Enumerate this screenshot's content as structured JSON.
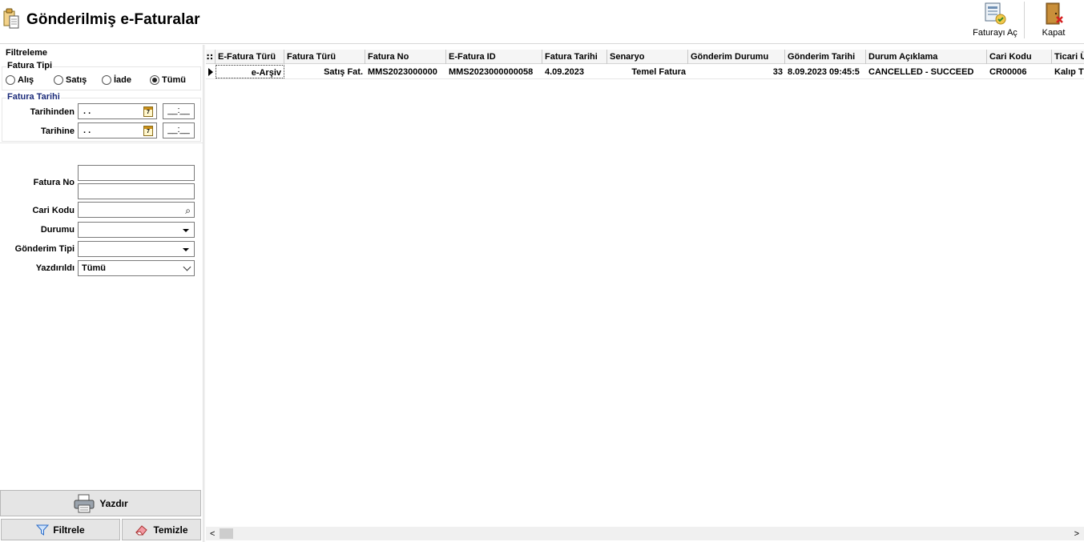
{
  "window": {
    "title": "Gönderilmiş e-Faturalar",
    "icon": "document-clipboard-icon"
  },
  "toolbar": {
    "open_invoice_label": "Faturayı Aç",
    "close_label": "Kapat"
  },
  "filter": {
    "title": "Filtreleme",
    "invoice_type": {
      "label": "Fatura Tipi",
      "options": [
        "Alış",
        "Satış",
        "İade",
        "Tümü"
      ],
      "selected": "Tümü"
    },
    "invoice_date": {
      "label": "Fatura Tarihi",
      "from_label": "Tarihinden",
      "to_label": "Tarihine",
      "from_value": ". .",
      "to_value": ". .",
      "from_time": "__:__",
      "to_time": "__:__"
    },
    "invoice_no_label": "Fatura No",
    "invoice_no_from": "",
    "invoice_no_to": "",
    "account_code_label": "Cari Kodu",
    "account_code_value": "",
    "status_label": "Durumu",
    "status_value": "",
    "send_type_label": "Gönderim Tipi",
    "send_type_value": "",
    "printed_label": "Yazdırıldı",
    "printed_value": "Tümü"
  },
  "buttons": {
    "print_label": "Yazdır",
    "filter_label": "Filtrele",
    "clear_label": "Temizle"
  },
  "grid": {
    "corner": "∷",
    "columns": [
      "E-Fatura Türü",
      "Fatura Türü",
      "Fatura No",
      "E-Fatura ID",
      "Fatura Tarihi",
      "Senaryo",
      "Gönderim Durumu",
      "Gönderim Tarihi",
      "Durum Açıklama",
      "Cari Kodu",
      "Ticari Ü"
    ],
    "rows": [
      [
        "e-Arşiv",
        "Satış Fat.",
        "MMS2023000000",
        "MMS2023000000058",
        "4.09.2023",
        "Temel Fatura",
        "33",
        "8.09.2023 09:45:5",
        "CANCELLED - SUCCEED",
        "CR00006",
        "Kalıp T"
      ]
    ]
  }
}
